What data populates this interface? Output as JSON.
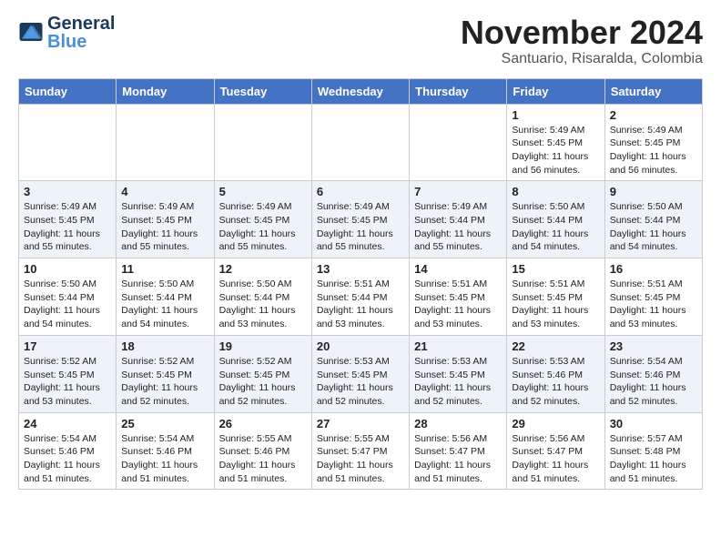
{
  "header": {
    "logo_general": "General",
    "logo_blue": "Blue",
    "title": "November 2024",
    "subtitle": "Santuario, Risaralda, Colombia"
  },
  "days_of_week": [
    "Sunday",
    "Monday",
    "Tuesday",
    "Wednesday",
    "Thursday",
    "Friday",
    "Saturday"
  ],
  "weeks": [
    [
      {
        "day": "",
        "info": ""
      },
      {
        "day": "",
        "info": ""
      },
      {
        "day": "",
        "info": ""
      },
      {
        "day": "",
        "info": ""
      },
      {
        "day": "",
        "info": ""
      },
      {
        "day": "1",
        "info": "Sunrise: 5:49 AM\nSunset: 5:45 PM\nDaylight: 11 hours\nand 56 minutes."
      },
      {
        "day": "2",
        "info": "Sunrise: 5:49 AM\nSunset: 5:45 PM\nDaylight: 11 hours\nand 56 minutes."
      }
    ],
    [
      {
        "day": "3",
        "info": "Sunrise: 5:49 AM\nSunset: 5:45 PM\nDaylight: 11 hours\nand 55 minutes."
      },
      {
        "day": "4",
        "info": "Sunrise: 5:49 AM\nSunset: 5:45 PM\nDaylight: 11 hours\nand 55 minutes."
      },
      {
        "day": "5",
        "info": "Sunrise: 5:49 AM\nSunset: 5:45 PM\nDaylight: 11 hours\nand 55 minutes."
      },
      {
        "day": "6",
        "info": "Sunrise: 5:49 AM\nSunset: 5:45 PM\nDaylight: 11 hours\nand 55 minutes."
      },
      {
        "day": "7",
        "info": "Sunrise: 5:49 AM\nSunset: 5:44 PM\nDaylight: 11 hours\nand 55 minutes."
      },
      {
        "day": "8",
        "info": "Sunrise: 5:50 AM\nSunset: 5:44 PM\nDaylight: 11 hours\nand 54 minutes."
      },
      {
        "day": "9",
        "info": "Sunrise: 5:50 AM\nSunset: 5:44 PM\nDaylight: 11 hours\nand 54 minutes."
      }
    ],
    [
      {
        "day": "10",
        "info": "Sunrise: 5:50 AM\nSunset: 5:44 PM\nDaylight: 11 hours\nand 54 minutes."
      },
      {
        "day": "11",
        "info": "Sunrise: 5:50 AM\nSunset: 5:44 PM\nDaylight: 11 hours\nand 54 minutes."
      },
      {
        "day": "12",
        "info": "Sunrise: 5:50 AM\nSunset: 5:44 PM\nDaylight: 11 hours\nand 53 minutes."
      },
      {
        "day": "13",
        "info": "Sunrise: 5:51 AM\nSunset: 5:44 PM\nDaylight: 11 hours\nand 53 minutes."
      },
      {
        "day": "14",
        "info": "Sunrise: 5:51 AM\nSunset: 5:45 PM\nDaylight: 11 hours\nand 53 minutes."
      },
      {
        "day": "15",
        "info": "Sunrise: 5:51 AM\nSunset: 5:45 PM\nDaylight: 11 hours\nand 53 minutes."
      },
      {
        "day": "16",
        "info": "Sunrise: 5:51 AM\nSunset: 5:45 PM\nDaylight: 11 hours\nand 53 minutes."
      }
    ],
    [
      {
        "day": "17",
        "info": "Sunrise: 5:52 AM\nSunset: 5:45 PM\nDaylight: 11 hours\nand 53 minutes."
      },
      {
        "day": "18",
        "info": "Sunrise: 5:52 AM\nSunset: 5:45 PM\nDaylight: 11 hours\nand 52 minutes."
      },
      {
        "day": "19",
        "info": "Sunrise: 5:52 AM\nSunset: 5:45 PM\nDaylight: 11 hours\nand 52 minutes."
      },
      {
        "day": "20",
        "info": "Sunrise: 5:53 AM\nSunset: 5:45 PM\nDaylight: 11 hours\nand 52 minutes."
      },
      {
        "day": "21",
        "info": "Sunrise: 5:53 AM\nSunset: 5:45 PM\nDaylight: 11 hours\nand 52 minutes."
      },
      {
        "day": "22",
        "info": "Sunrise: 5:53 AM\nSunset: 5:46 PM\nDaylight: 11 hours\nand 52 minutes."
      },
      {
        "day": "23",
        "info": "Sunrise: 5:54 AM\nSunset: 5:46 PM\nDaylight: 11 hours\nand 52 minutes."
      }
    ],
    [
      {
        "day": "24",
        "info": "Sunrise: 5:54 AM\nSunset: 5:46 PM\nDaylight: 11 hours\nand 51 minutes."
      },
      {
        "day": "25",
        "info": "Sunrise: 5:54 AM\nSunset: 5:46 PM\nDaylight: 11 hours\nand 51 minutes."
      },
      {
        "day": "26",
        "info": "Sunrise: 5:55 AM\nSunset: 5:46 PM\nDaylight: 11 hours\nand 51 minutes."
      },
      {
        "day": "27",
        "info": "Sunrise: 5:55 AM\nSunset: 5:47 PM\nDaylight: 11 hours\nand 51 minutes."
      },
      {
        "day": "28",
        "info": "Sunrise: 5:56 AM\nSunset: 5:47 PM\nDaylight: 11 hours\nand 51 minutes."
      },
      {
        "day": "29",
        "info": "Sunrise: 5:56 AM\nSunset: 5:47 PM\nDaylight: 11 hours\nand 51 minutes."
      },
      {
        "day": "30",
        "info": "Sunrise: 5:57 AM\nSunset: 5:48 PM\nDaylight: 11 hours\nand 51 minutes."
      }
    ]
  ]
}
